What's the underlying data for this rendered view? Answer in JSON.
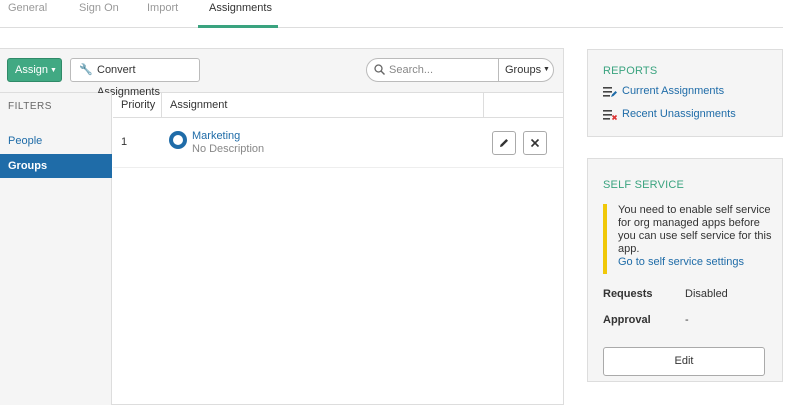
{
  "tabs": [
    {
      "label": "General"
    },
    {
      "label": "Sign On"
    },
    {
      "label": "Import"
    },
    {
      "label": "Assignments",
      "active": true
    }
  ],
  "toolbar": {
    "assign_label": "Assign",
    "convert_label": "Convert Assignments",
    "search_placeholder": "Search...",
    "search_value": "",
    "filter_select": "Groups"
  },
  "filters": {
    "heading": "FILTERS",
    "items": [
      {
        "label": "People",
        "active": false
      },
      {
        "label": "Groups",
        "active": true
      }
    ]
  },
  "table": {
    "columns": [
      "Priority",
      "Assignment"
    ],
    "rows": [
      {
        "priority": "1",
        "name": "Marketing",
        "description": "No Description"
      }
    ]
  },
  "reports": {
    "title": "REPORTS",
    "links": [
      "Current Assignments",
      "Recent Unassignments"
    ]
  },
  "self_service": {
    "title": "SELF SERVICE",
    "notice": "You need to enable self service for org managed apps before you can use self service for this app.",
    "link": "Go to self service settings",
    "requests_label": "Requests",
    "requests_value": "Disabled",
    "approval_label": "Approval",
    "approval_value": "-",
    "edit_label": "Edit"
  },
  "colors": {
    "accent_green": "#41a983",
    "link_blue": "#1f6ca8",
    "notice_yellow": "#f0c808"
  }
}
